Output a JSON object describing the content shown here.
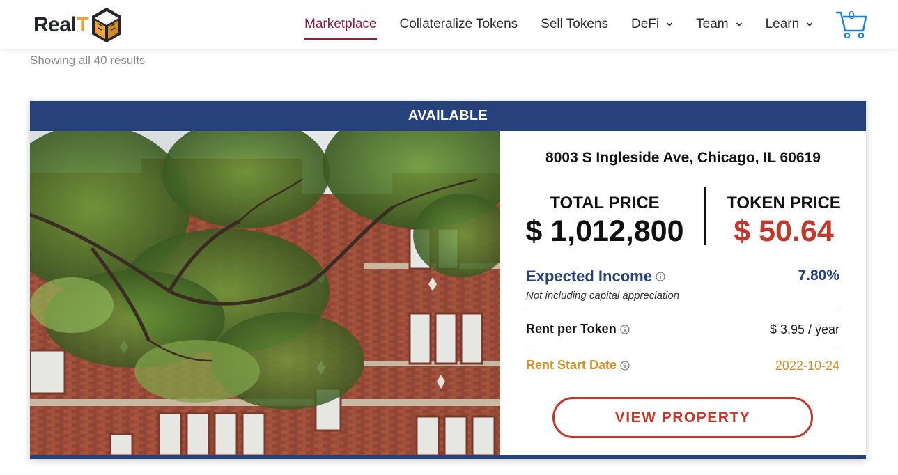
{
  "header": {
    "logo": {
      "text_main": "Real",
      "text_accent": "T"
    },
    "nav": [
      {
        "label": "Marketplace",
        "active": true,
        "dropdown": false
      },
      {
        "label": "Collateralize Tokens",
        "active": false,
        "dropdown": false
      },
      {
        "label": "Sell Tokens",
        "active": false,
        "dropdown": false
      },
      {
        "label": "DeFi",
        "active": false,
        "dropdown": true
      },
      {
        "label": "Team",
        "active": false,
        "dropdown": true
      },
      {
        "label": "Learn",
        "active": false,
        "dropdown": true
      }
    ],
    "cart": {
      "count": "0",
      "icon": "cart-icon"
    }
  },
  "results_text": "Showing all 40 results",
  "card": {
    "status": "AVAILABLE",
    "address": "8003 S Ingleside Ave, Chicago, IL 60619",
    "total_price_label": "TOTAL PRICE",
    "total_price": "$ 1,012,800",
    "token_price_label": "TOKEN PRICE",
    "token_price": "$ 50.64",
    "expected_income_label": "Expected Income",
    "expected_income_value": "7.80%",
    "expected_income_note": "Not including capital appreciation",
    "rent_label": "Rent per Token",
    "rent_value": "$ 3.95 / year",
    "start_label": "Rent Start Date",
    "start_value": "2022-10-24",
    "button_label": "VIEW PROPERTY"
  },
  "colors": {
    "primary_navy": "#27417a",
    "accent_red": "#c0392b",
    "nav_active": "#8b1e3f",
    "gold": "#d4902a",
    "cart_blue": "#1f7fd6"
  }
}
